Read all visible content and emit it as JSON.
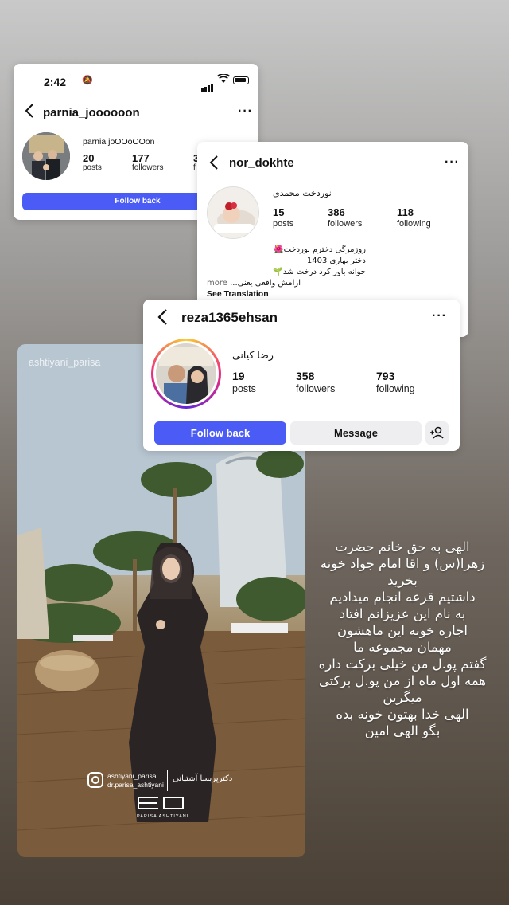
{
  "status_bar": {
    "time": "2:42"
  },
  "card1": {
    "username": "parnia_joooooon",
    "display_name": "parnia joOOoOOon",
    "posts": "20",
    "posts_label": "posts",
    "followers": "177",
    "followers_label": "followers",
    "following_partial": "3",
    "following_partial_label": "f",
    "follow_back": "Follow back"
  },
  "card2": {
    "username": "nor_dokhte",
    "display_name": "نوردخت محمدی",
    "posts": "15",
    "posts_label": "posts",
    "followers": "386",
    "followers_label": "followers",
    "following": "118",
    "following_label": "following",
    "bio": [
      "روزمرگی دخترم نوردخت🌺",
      "دختر بهاری 1403",
      "جوانه باور کرد درخت شد🌱",
      "ارامش واقعی یعنی..."
    ],
    "more": "more",
    "see_translation": "See Translation"
  },
  "card3": {
    "username": "reza1365ehsan",
    "display_name": "رضا کیانی",
    "posts": "19",
    "posts_label": "posts",
    "followers": "358",
    "followers_label": "followers",
    "following": "793",
    "following_label": "following",
    "follow_back": "Follow back",
    "message": "Message"
  },
  "story": {
    "account_watermark": "ashtiyani_parisa",
    "handle1": "ashtiyani_parisa",
    "handle2": "dr.parisa_ashtiyani",
    "signature": "دکترپریسا آشتیانی",
    "logo_caption": "PARISA ASHTIYANI",
    "text_lines": [
      "الهی به حق خانم حضرت",
      "زهرا(س) و اقا امام جواد خونه",
      "بخرید",
      "داشتیم قرعه انجام میدادیم",
      "به نام این عزیزانم افتاد",
      "اجاره خونه این ماهشون",
      "مهمان مجموعه ما",
      "گفتم پو.ل من خیلی برکت داره",
      "همه اول ماه از من پو.ل برکتی",
      "میگرین",
      "الهی خدا بهتون خونه بده",
      "بگو الهی امین"
    ]
  }
}
